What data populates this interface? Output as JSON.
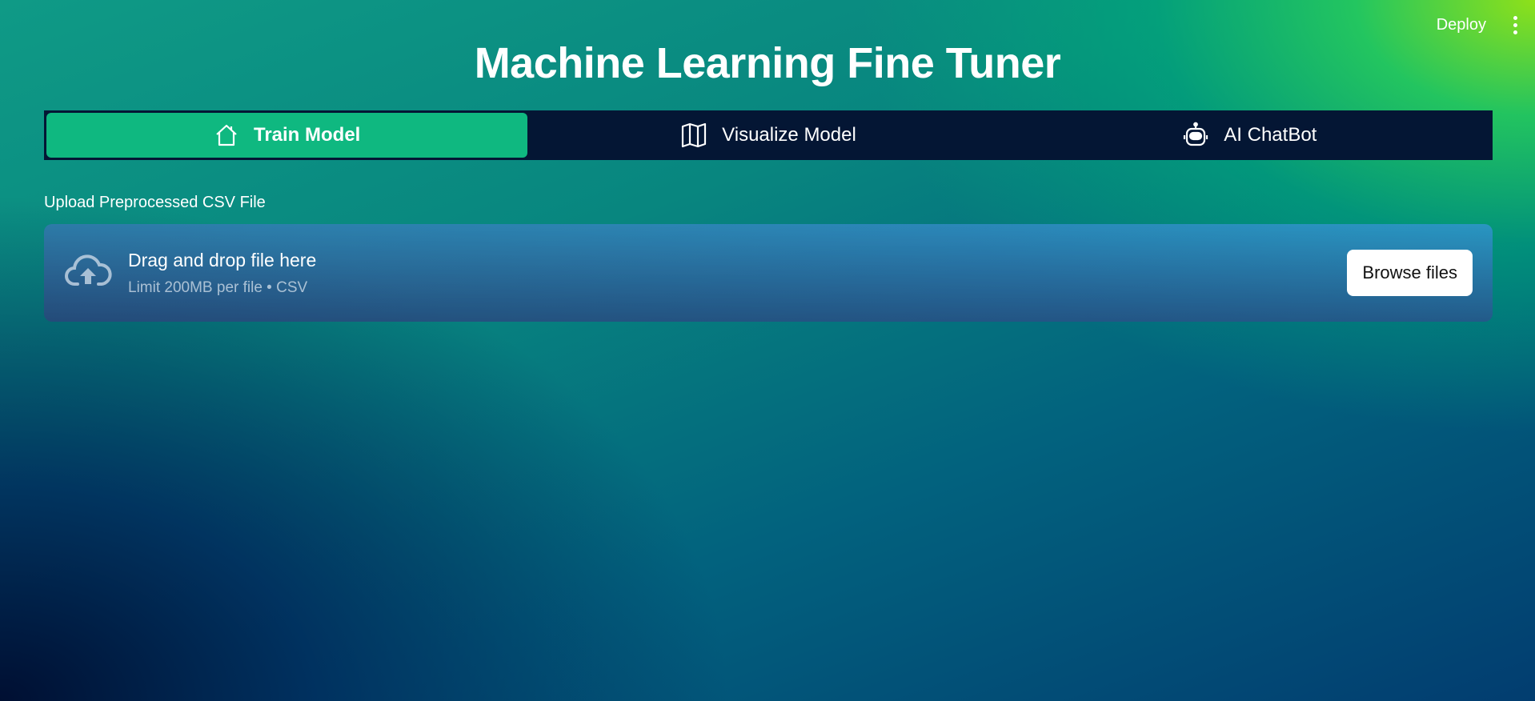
{
  "toolbar": {
    "deploy_label": "Deploy",
    "menu_icon": "more-vertical-icon"
  },
  "page": {
    "title": "Machine Learning Fine Tuner"
  },
  "nav": {
    "tabs": [
      {
        "label": "Train Model",
        "icon": "home-icon",
        "active": true
      },
      {
        "label": "Visualize Model",
        "icon": "map-icon",
        "active": false
      },
      {
        "label": "AI ChatBot",
        "icon": "robot-icon",
        "active": false
      }
    ]
  },
  "uploader": {
    "label": "Upload Preprocessed CSV File",
    "dropzone_title": "Drag and drop file here",
    "dropzone_subtitle": "Limit 200MB per file • CSV",
    "browse_label": "Browse files",
    "icon": "cloud-upload-icon"
  },
  "colors": {
    "nav_background": "#041634",
    "active_tab": "#0fb880"
  }
}
